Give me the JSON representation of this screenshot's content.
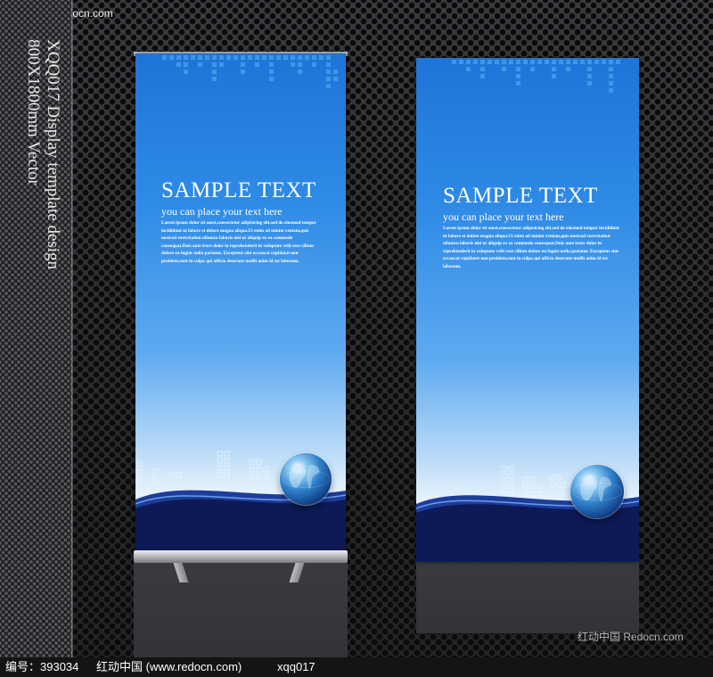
{
  "watermark_top": "红动中国 Redocn.com",
  "watermark_bottom_right": "红动中国 Redocn.com",
  "side_title": {
    "line1": "XQQ017 Display template design",
    "line2": "800X1800mm Vector"
  },
  "banners": [
    {
      "title": "SAMPLE TEXT",
      "subtitle": "you can place your text here",
      "body": "Lorem ipsum dolor sit amet,consectetur adipisicing elit,sed do eiusmod tempor incididunt ut labore et dolore magna aliqua.Ut enim ad minim veniam,quis nostrud exercitation ullamco laboris nisi ut aliquip ex ea commodo consequat.Duis aute irure dolor in reprehenderit in voluptate velit esse cillum dolore eu fugiat nulla pariatur. Excepteur sint occaecat cupidatat non proident,sunt in culpa qui officia deserunt mollit anim id est laborum."
    },
    {
      "title": "SAMPLE TEXT",
      "subtitle": "you can place your text here",
      "body": "Lorem ipsum dolor sit amet,consectetur adipisicing elit,sed do eiusmod tempor incididunt ut labore et dolore magna aliqua.Ut enim ad minim veniam,quis nostrud exercitation ullamco laboris nisi ut aliquip ex ea commodo consequat.Duis aute irure dolor in reprehenderit in voluptate velit esse cillum dolore eu fugiat nulla pariatur. Excepteur sint occaecat cupidatat non proident,sunt in culpa qui officia deserunt mollit anim id est laborum."
    }
  ],
  "footer": {
    "id_label": "编号：393034",
    "site": "红动中国 (www.redocn.com)",
    "code": "xqq017"
  },
  "colors": {
    "banner_blue": "#2f8be6",
    "wave_navy": "#0d1a55",
    "background_metal": "#2c2d2f"
  },
  "icons": [
    "globe-icon"
  ]
}
